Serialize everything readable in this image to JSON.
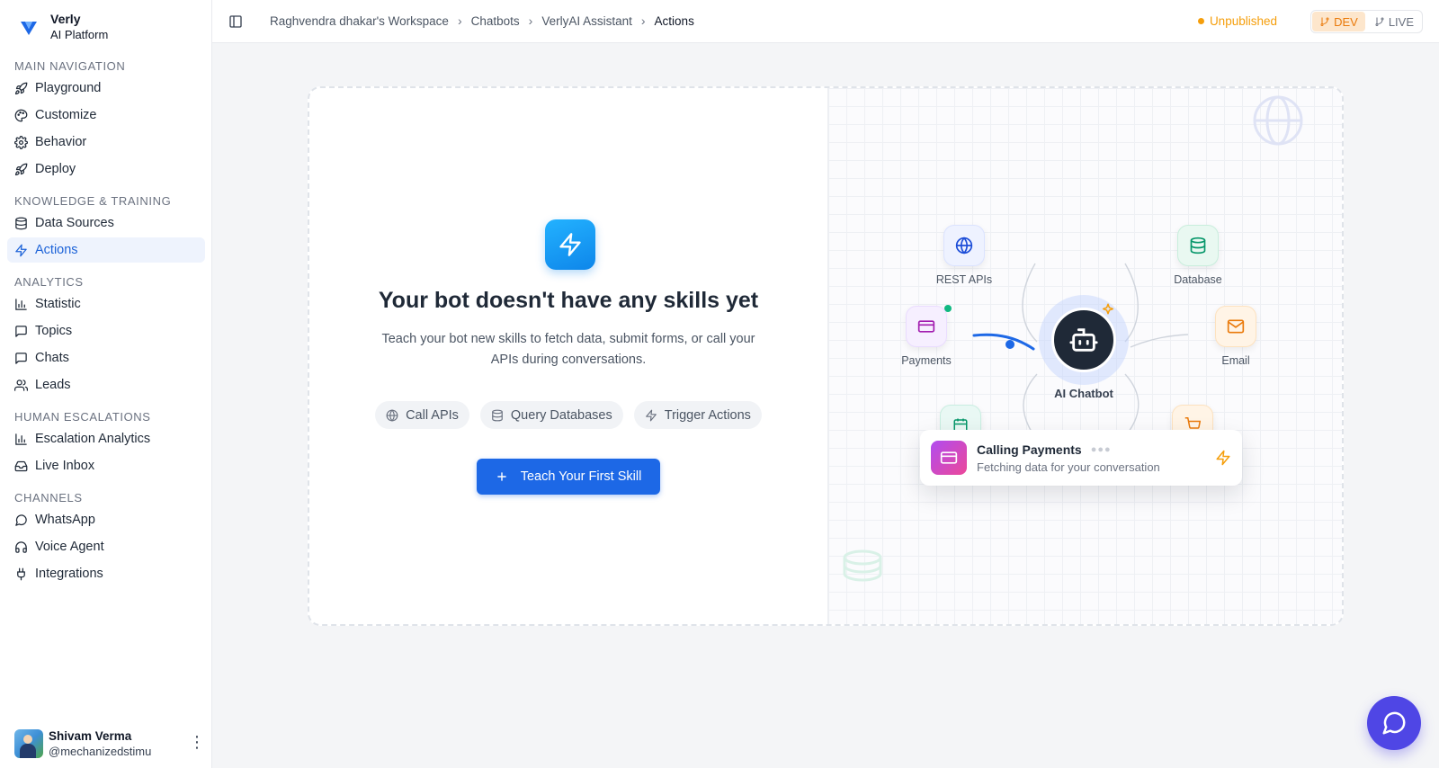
{
  "brand": {
    "name": "Verly",
    "subtitle": "AI Platform"
  },
  "sidebar": {
    "sections": [
      {
        "title": "MAIN NAVIGATION",
        "items": [
          {
            "label": "Playground",
            "icon": "rocket-icon"
          },
          {
            "label": "Customize",
            "icon": "palette-icon"
          },
          {
            "label": "Behavior",
            "icon": "gear-icon"
          },
          {
            "label": "Deploy",
            "icon": "rocket-icon"
          }
        ]
      },
      {
        "title": "KNOWLEDGE & TRAINING",
        "items": [
          {
            "label": "Data Sources",
            "icon": "database-icon"
          },
          {
            "label": "Actions",
            "icon": "bolt-icon",
            "active": true
          }
        ]
      },
      {
        "title": "ANALYTICS",
        "items": [
          {
            "label": "Statistic",
            "icon": "bar-chart-icon"
          },
          {
            "label": "Topics",
            "icon": "message-square-icon"
          },
          {
            "label": "Chats",
            "icon": "message-square-icon"
          },
          {
            "label": "Leads",
            "icon": "users-icon"
          }
        ]
      },
      {
        "title": "HUMAN ESCALATIONS",
        "items": [
          {
            "label": "Escalation Analytics",
            "icon": "bar-chart-icon"
          },
          {
            "label": "Live Inbox",
            "icon": "inbox-icon"
          }
        ]
      },
      {
        "title": "CHANNELS",
        "items": [
          {
            "label": "WhatsApp",
            "icon": "message-circle-icon"
          },
          {
            "label": "Voice Agent",
            "icon": "headphones-icon"
          },
          {
            "label": "Integrations",
            "icon": "plug-icon"
          }
        ]
      }
    ]
  },
  "user": {
    "name": "Shivam Verma",
    "handle": "@mechanizedstimu"
  },
  "header": {
    "breadcrumbs": [
      "Raghvendra dhakar's Workspace",
      "Chatbots",
      "VerlyAI Assistant",
      "Actions"
    ],
    "status": "Unpublished",
    "env_dev": "DEV",
    "env_live": "LIVE"
  },
  "empty_state": {
    "title": "Your bot doesn't have any skills yet",
    "description": "Teach your bot new skills to fetch data, submit forms, or call your APIs during conversations.",
    "chips": [
      {
        "label": "Call APIs",
        "icon": "globe-icon"
      },
      {
        "label": "Query Databases",
        "icon": "database-icon"
      },
      {
        "label": "Trigger Actions",
        "icon": "bolt-icon"
      }
    ],
    "cta": "Teach Your First Skill"
  },
  "diagram": {
    "center": "AI Chatbot",
    "nodes": [
      {
        "label": "REST APIs",
        "icon": "globe-icon"
      },
      {
        "label": "Database",
        "icon": "database-icon"
      },
      {
        "label": "Payments",
        "icon": "credit-card-icon"
      },
      {
        "label": "Email",
        "icon": "mail-icon"
      }
    ],
    "toast": {
      "title": "Calling Payments",
      "subtitle": "Fetching data for your conversation"
    }
  },
  "colors": {
    "accent": "#1d68e6",
    "active_bg": "#eef3fd",
    "warning": "#f59e0b",
    "fab": "#4f46e5"
  }
}
